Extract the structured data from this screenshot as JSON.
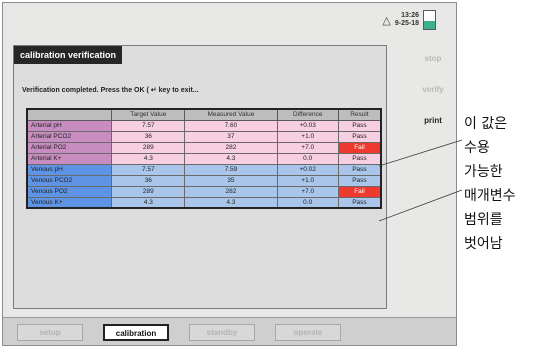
{
  "status": {
    "time": "13:26",
    "date": "9-25-18",
    "battery_level": 0.45,
    "icons": [
      "bell-icon",
      "battery-icon"
    ]
  },
  "side_menu": {
    "items": [
      {
        "label": "stop",
        "enabled": false
      },
      {
        "label": "verify",
        "enabled": false
      },
      {
        "label": "print",
        "enabled": true
      }
    ]
  },
  "panel": {
    "title": "calibration verification",
    "message": "Verification completed. Press the OK ( ↵ key to exit..."
  },
  "table": {
    "headers": [
      "",
      "Target Value",
      "Measured Value",
      "Difference",
      "Result"
    ],
    "rows": [
      {
        "group": "arterial",
        "name": "Arterial pH",
        "target": "7.57",
        "measured": "7.60",
        "difference": "+0.03",
        "result": "Pass"
      },
      {
        "group": "arterial",
        "name": "Arterial PCO2",
        "target": "36",
        "measured": "37",
        "difference": "+1.0",
        "result": "Pass"
      },
      {
        "group": "arterial",
        "name": "Arterial PO2",
        "target": "289",
        "measured": "282",
        "difference": "+7.0",
        "result": "Fail"
      },
      {
        "group": "arterial",
        "name": "Arterial K+",
        "target": "4.3",
        "measured": "4.3",
        "difference": "0.0",
        "result": "Pass"
      },
      {
        "group": "venous",
        "name": "Venous pH",
        "target": "7.57",
        "measured": "7.59",
        "difference": "+0.02",
        "result": "Pass"
      },
      {
        "group": "venous",
        "name": "Venous PCO2",
        "target": "36",
        "measured": "35",
        "difference": "+1.0",
        "result": "Pass"
      },
      {
        "group": "venous",
        "name": "Venous PO2",
        "target": "289",
        "measured": "282",
        "difference": "+7.0",
        "result": "Fail"
      },
      {
        "group": "venous",
        "name": "Venous K+",
        "target": "4.3",
        "measured": "4.3",
        "difference": "0.0",
        "result": "Pass"
      }
    ]
  },
  "bottom_tabs": [
    {
      "label": "setup",
      "active": false
    },
    {
      "label": "calibration",
      "active": true
    },
    {
      "label": "standby",
      "active": false
    },
    {
      "label": "operate",
      "active": false
    }
  ],
  "annotation": {
    "lines": [
      "이 값은",
      "수용",
      "가능한",
      "매개변수",
      "범위를",
      "벗어남"
    ]
  },
  "colors": {
    "arterial_name": "#c78cc0",
    "arterial_row": "#f8cfe0",
    "venous_name": "#5f93e3",
    "venous_row": "#a9c6ea",
    "fail": "#ee3a2e",
    "title_bar": "#262626",
    "battery": "#3cb08f"
  }
}
